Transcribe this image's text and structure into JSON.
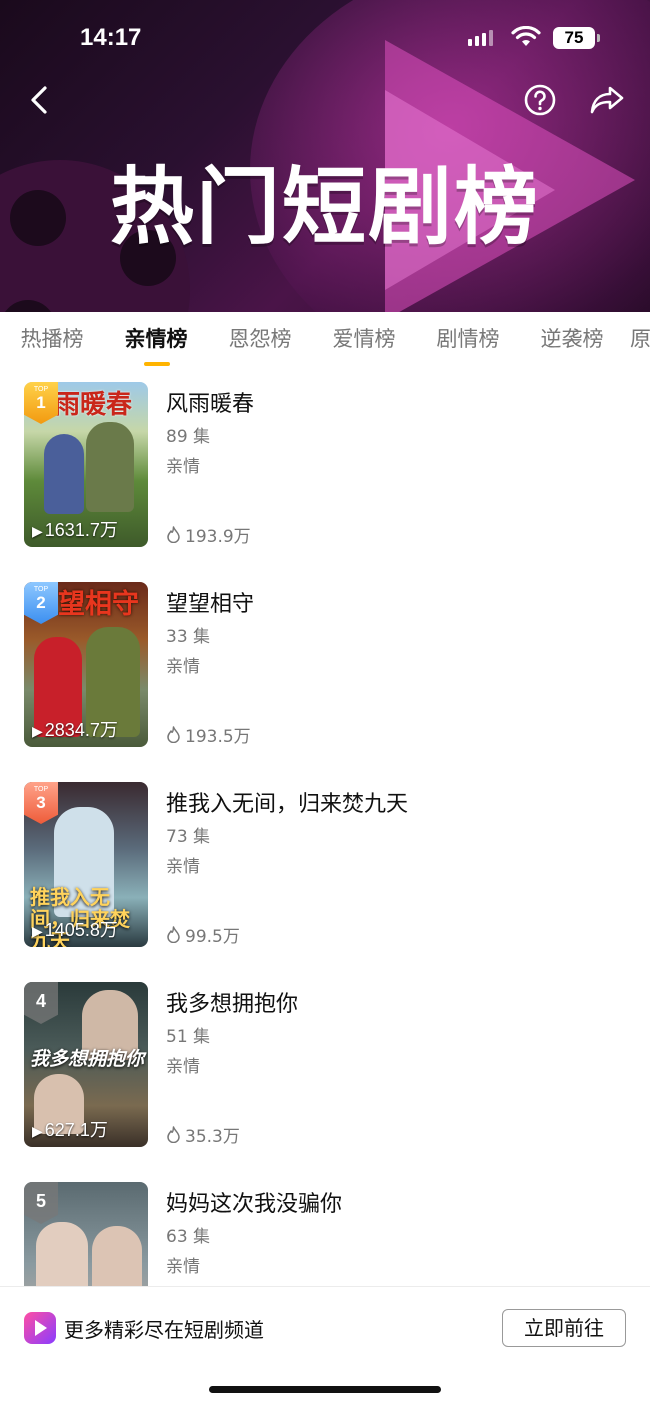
{
  "status_bar": {
    "time": "14:17",
    "battery": "75"
  },
  "header": {
    "title": "热门短剧榜"
  },
  "tabs": [
    {
      "label": "热播榜",
      "active": false
    },
    {
      "label": "亲情榜",
      "active": true
    },
    {
      "label": "恩怨榜",
      "active": false
    },
    {
      "label": "爱情榜",
      "active": false
    },
    {
      "label": "剧情榜",
      "active": false
    },
    {
      "label": "逆袭榜",
      "active": false
    },
    {
      "label": "原",
      "active": false
    }
  ],
  "items": [
    {
      "rank": "1",
      "badge_top": "TOP",
      "title": "风雨暖春",
      "episodes": "89 集",
      "genre": "亲情",
      "views": "1631.7万",
      "heat": "193.9万",
      "cover_text": "雨暖春"
    },
    {
      "rank": "2",
      "badge_top": "TOP",
      "title": "望望相守",
      "episodes": "33 集",
      "genre": "亲情",
      "views": "2834.7万",
      "heat": "193.5万",
      "cover_text": "望相守"
    },
    {
      "rank": "3",
      "badge_top": "TOP",
      "title": "推我入无间，归来焚九天",
      "episodes": "73 集",
      "genre": "亲情",
      "views": "1405.8万",
      "heat": "99.5万",
      "cover_text": "推我入无间，归来焚九天"
    },
    {
      "rank": "4",
      "title": "我多想拥抱你",
      "episodes": "51 集",
      "genre": "亲情",
      "views": "627.1万",
      "heat": "35.3万",
      "cover_text": "我多想拥抱你"
    },
    {
      "rank": "5",
      "title": "妈妈这次我没骗你",
      "episodes": "63 集",
      "genre": "亲情",
      "views": "",
      "heat": "",
      "cover_text": ""
    }
  ],
  "bottom_bar": {
    "promo": "更多精彩尽在短剧频道",
    "button": "立即前往"
  },
  "colors": {
    "accent": "#ffb400",
    "banner_bg": "#2a1030"
  }
}
